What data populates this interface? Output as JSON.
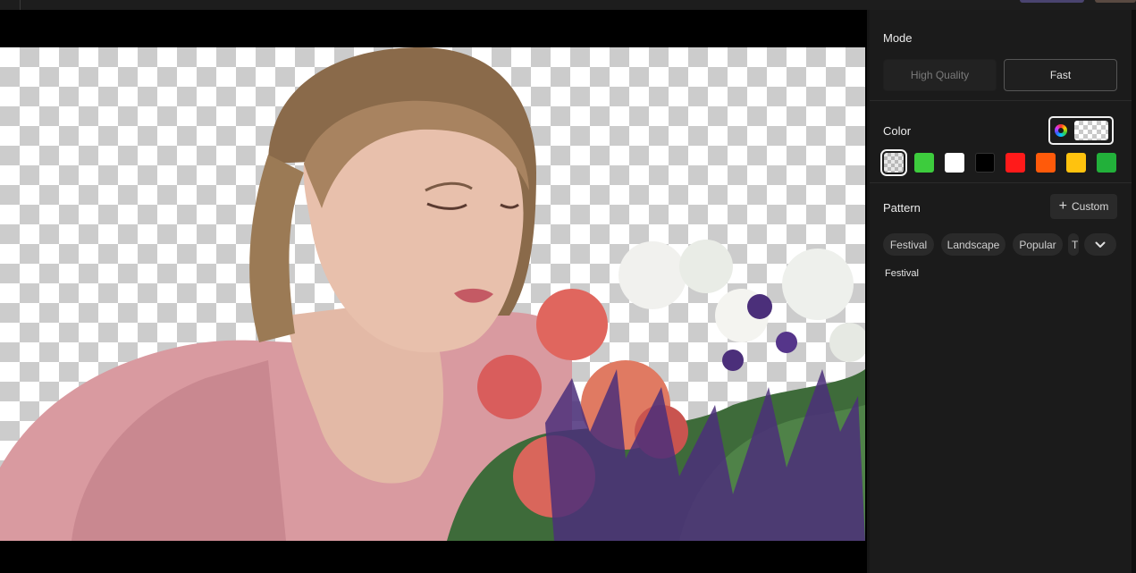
{
  "panel": {
    "mode": {
      "label": "Mode",
      "options": [
        "High Quality",
        "Fast"
      ],
      "selected": "Fast"
    },
    "color": {
      "label": "Color",
      "selected": "transparent",
      "swatches": [
        "transparent",
        "#3dcc3d",
        "#ffffff",
        "#000000",
        "#ff1a1a",
        "#ff5a0a",
        "#ffc20e",
        "#22b03a"
      ]
    },
    "pattern": {
      "label": "Pattern",
      "custom_label": "Custom",
      "chips": [
        "Festival",
        "Landscape",
        "Popular",
        "T"
      ],
      "more_icon": "chevron-down-icon",
      "active_category": "Festival"
    }
  },
  "colors": {
    "panel_bg": "#1b1b1b",
    "accent_border": "#f0f0f0",
    "chip_bg": "#2a2a2a"
  }
}
